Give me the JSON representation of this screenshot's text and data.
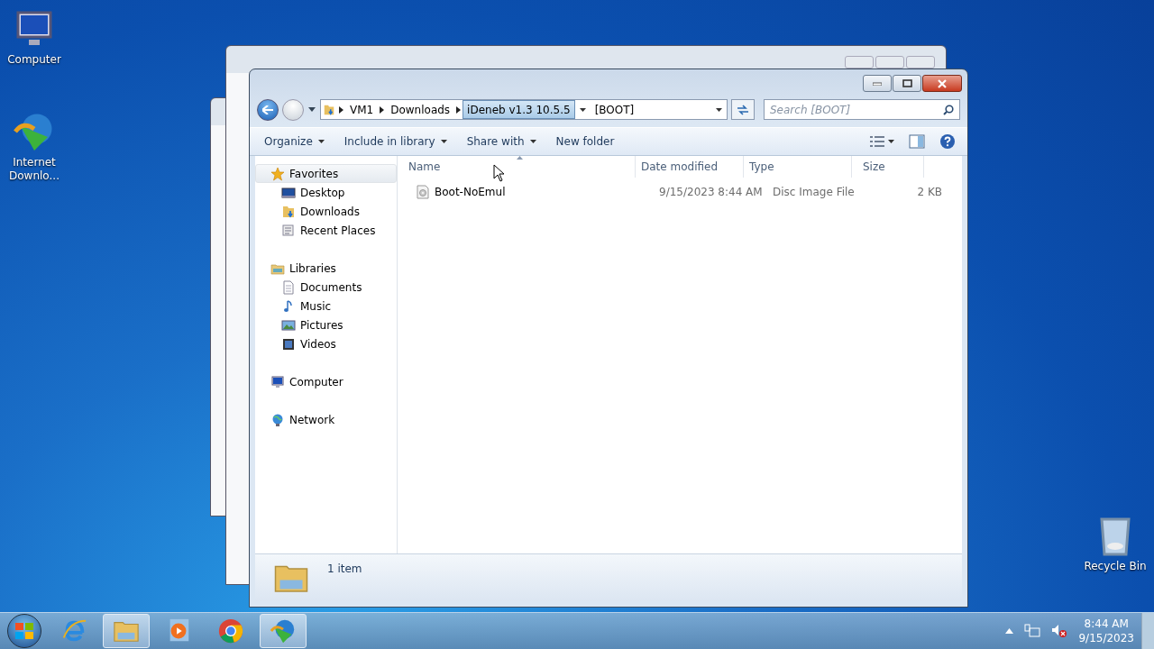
{
  "desktop_icons": [
    {
      "kind": "computer",
      "label": "Computer"
    },
    {
      "kind": "download-manager",
      "label": "Internet Downlo..."
    },
    {
      "kind": "recycle-bin",
      "label": "Recycle Bin"
    }
  ],
  "explorer": {
    "breadcrumb": [
      {
        "label": "VM1",
        "highlighted": false
      },
      {
        "label": "Downloads",
        "highlighted": false
      },
      {
        "label": "iDeneb v1.3 10.5.5",
        "highlighted": true
      }
    ],
    "address_text": "[BOOT]",
    "search": {
      "placeholder": "Search [BOOT]"
    },
    "toolbar": [
      {
        "label": "Organize",
        "dropdown": true
      },
      {
        "label": "Include in library",
        "dropdown": true
      },
      {
        "label": "Share with",
        "dropdown": true
      },
      {
        "label": "New folder",
        "dropdown": false
      }
    ],
    "navigation": [
      {
        "kind": "favorites",
        "label": "Favorites",
        "selected": true,
        "children": [
          {
            "kind": "desktop",
            "label": "Desktop",
            "selected": false
          },
          {
            "kind": "downloads",
            "label": "Downloads",
            "selected": false
          },
          {
            "kind": "recent",
            "label": "Recent Places",
            "selected": false
          }
        ]
      },
      {
        "kind": "libraries",
        "label": "Libraries",
        "selected": false,
        "children": [
          {
            "kind": "documents",
            "label": "Documents",
            "selected": false
          },
          {
            "kind": "music",
            "label": "Music",
            "selected": false
          },
          {
            "kind": "pictures",
            "label": "Pictures",
            "selected": false
          },
          {
            "kind": "videos",
            "label": "Videos",
            "selected": false
          }
        ]
      },
      {
        "kind": "computer",
        "label": "Computer",
        "selected": false
      },
      {
        "kind": "network",
        "label": "Network",
        "selected": false
      }
    ],
    "columns": [
      {
        "label": "Name",
        "sorted": true
      },
      {
        "label": "Date modified",
        "sorted": false
      },
      {
        "label": "Type",
        "sorted": false
      },
      {
        "label": "Size",
        "sorted": false
      }
    ],
    "files": [
      {
        "name": "Boot-NoEmul",
        "date_modified": "9/15/2023 8:44 AM",
        "type": "Disc Image File",
        "size": "2 KB"
      }
    ],
    "details": "1 item"
  },
  "taskbar": {
    "items": [
      {
        "kind": "browser-e",
        "active": false
      },
      {
        "kind": "folders",
        "active": true
      },
      {
        "kind": "media-player",
        "active": false
      },
      {
        "kind": "chrome",
        "active": false
      },
      {
        "kind": "download-manager",
        "active": true
      }
    ],
    "clock": {
      "time": "8:44 AM",
      "date": "9/15/2023"
    }
  }
}
